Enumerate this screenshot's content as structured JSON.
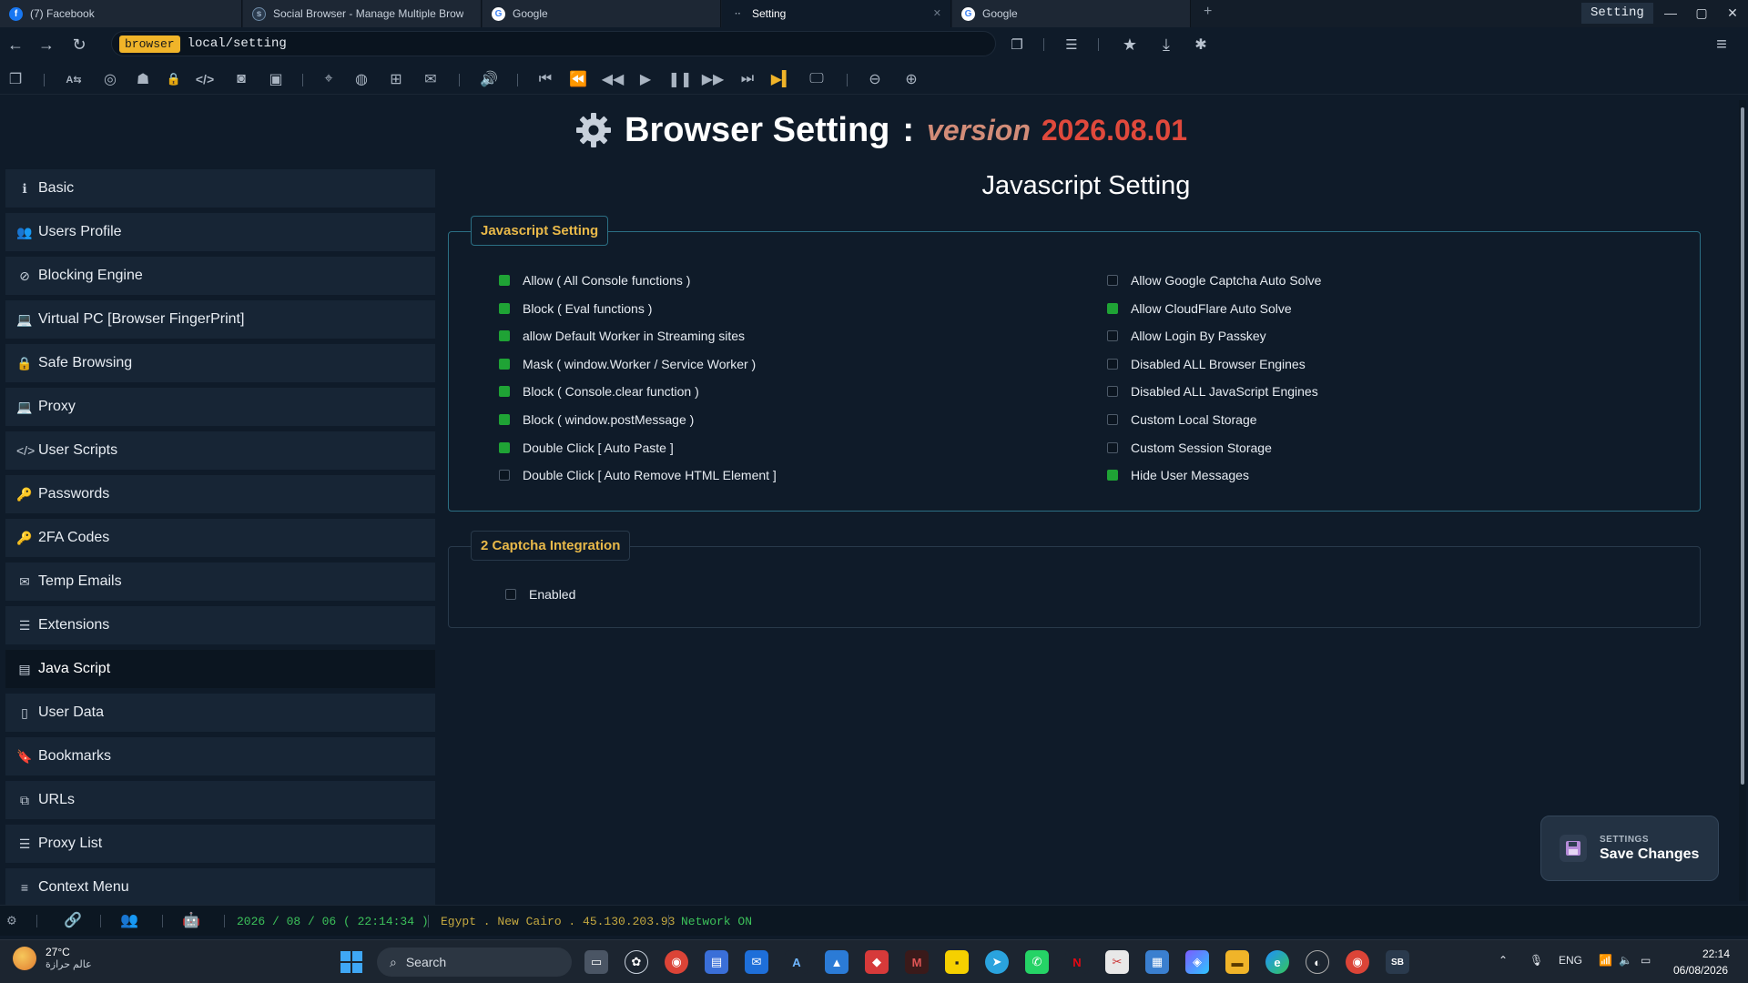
{
  "tabs": [
    {
      "label": "(7) Facebook",
      "icon": "facebook-icon"
    },
    {
      "label": "Social Browser - Manage Multiple Brow",
      "icon": "social-browser-icon"
    },
    {
      "label": "Google",
      "icon": "google-icon"
    },
    {
      "label": "Setting",
      "icon": "loading-icon",
      "active": true
    },
    {
      "label": "Google",
      "icon": "google-icon"
    }
  ],
  "window_title": "Setting",
  "address": {
    "scheme": "browser",
    "url": "local/setting"
  },
  "page": {
    "title": "Browser Setting",
    "separator": ":",
    "version_label": "version",
    "version_number": "2026.08.01"
  },
  "sidebar": {
    "items": [
      {
        "label": "Basic",
        "icon": "info-icon",
        "glyph": "ℹ"
      },
      {
        "label": "Users Profile",
        "icon": "users-icon",
        "glyph": "👥"
      },
      {
        "label": "Blocking Engine",
        "icon": "block-icon",
        "glyph": "⊘"
      },
      {
        "label": "Virtual PC [Browser FingerPrint]",
        "icon": "laptop-icon",
        "glyph": "💻"
      },
      {
        "label": "Safe Browsing",
        "icon": "lock-icon",
        "glyph": "🔒"
      },
      {
        "label": "Proxy",
        "icon": "laptop-icon",
        "glyph": "💻"
      },
      {
        "label": "User Scripts",
        "icon": "code-icon",
        "glyph": "</>"
      },
      {
        "label": "Passwords",
        "icon": "key-icon",
        "glyph": "🔑"
      },
      {
        "label": "2FA Codes",
        "icon": "key-icon",
        "glyph": "🔑"
      },
      {
        "label": "Temp Emails",
        "icon": "envelope-icon",
        "glyph": "✉"
      },
      {
        "label": "Extensions",
        "icon": "list-icon",
        "glyph": "☰"
      },
      {
        "label": "Java Script",
        "icon": "terminal-icon",
        "glyph": "▤",
        "active": true
      },
      {
        "label": "User Data",
        "icon": "file-icon",
        "glyph": "▯"
      },
      {
        "label": "Bookmarks",
        "icon": "bookmark-icon",
        "glyph": "🔖"
      },
      {
        "label": "URLs",
        "icon": "sitemap-icon",
        "glyph": "⧉"
      },
      {
        "label": "Proxy List",
        "icon": "list-icon",
        "glyph": "☰"
      },
      {
        "label": "Context Menu",
        "icon": "menu-icon",
        "glyph": "≡"
      }
    ]
  },
  "main": {
    "section_title": "Javascript Setting",
    "js_group": {
      "legend": "Javascript Setting",
      "left": [
        {
          "label": "Allow ( All Console functions )",
          "checked": true
        },
        {
          "label": "Block ( Eval functions )",
          "checked": true
        },
        {
          "label": "allow Default Worker in Streaming sites",
          "checked": true
        },
        {
          "label": "Mask ( window.Worker / Service Worker )",
          "checked": true
        },
        {
          "label": "Block ( Console.clear function )",
          "checked": true
        },
        {
          "label": "Block ( window.postMessage )",
          "checked": true
        },
        {
          "label": "Double Click [ Auto Paste ]",
          "checked": true
        },
        {
          "label": "Double Click [ Auto Remove HTML Element ]",
          "checked": false
        }
      ],
      "right": [
        {
          "label": "Allow Google Captcha Auto Solve",
          "checked": false
        },
        {
          "label": "Allow CloudFlare Auto Solve",
          "checked": true
        },
        {
          "label": "Allow Login By Passkey",
          "checked": false
        },
        {
          "label": "Disabled ALL Browser Engines",
          "checked": false
        },
        {
          "label": "Disabled ALL JavaScript Engines",
          "checked": false
        },
        {
          "label": "Custom Local Storage",
          "checked": false
        },
        {
          "label": "Custom Session Storage",
          "checked": false
        },
        {
          "label": "Hide User Messages",
          "checked": true
        }
      ]
    },
    "captcha_group": {
      "legend": "2 Captcha Integration",
      "enabled_label": "Enabled",
      "enabled": false
    }
  },
  "save_button": {
    "kicker": "SETTINGS",
    "label": "Save Changes"
  },
  "status": {
    "datetime": "2026 / 08 / 06 ( 22:14:34 )",
    "location": "Egypt . New Cairo . 45.130.203.93",
    "network": "Network ON"
  },
  "taskbar": {
    "temperature": "27°C",
    "weather_city": "عالم حرازة",
    "search_label": "Search",
    "language": "ENG",
    "time": "22:14",
    "date": "06/08/2026"
  },
  "colors": {
    "accent": "#f0b429",
    "checked": "#1fa335",
    "version": "#e0493c",
    "legend": "#e9b949",
    "network": "#3cc15a"
  }
}
